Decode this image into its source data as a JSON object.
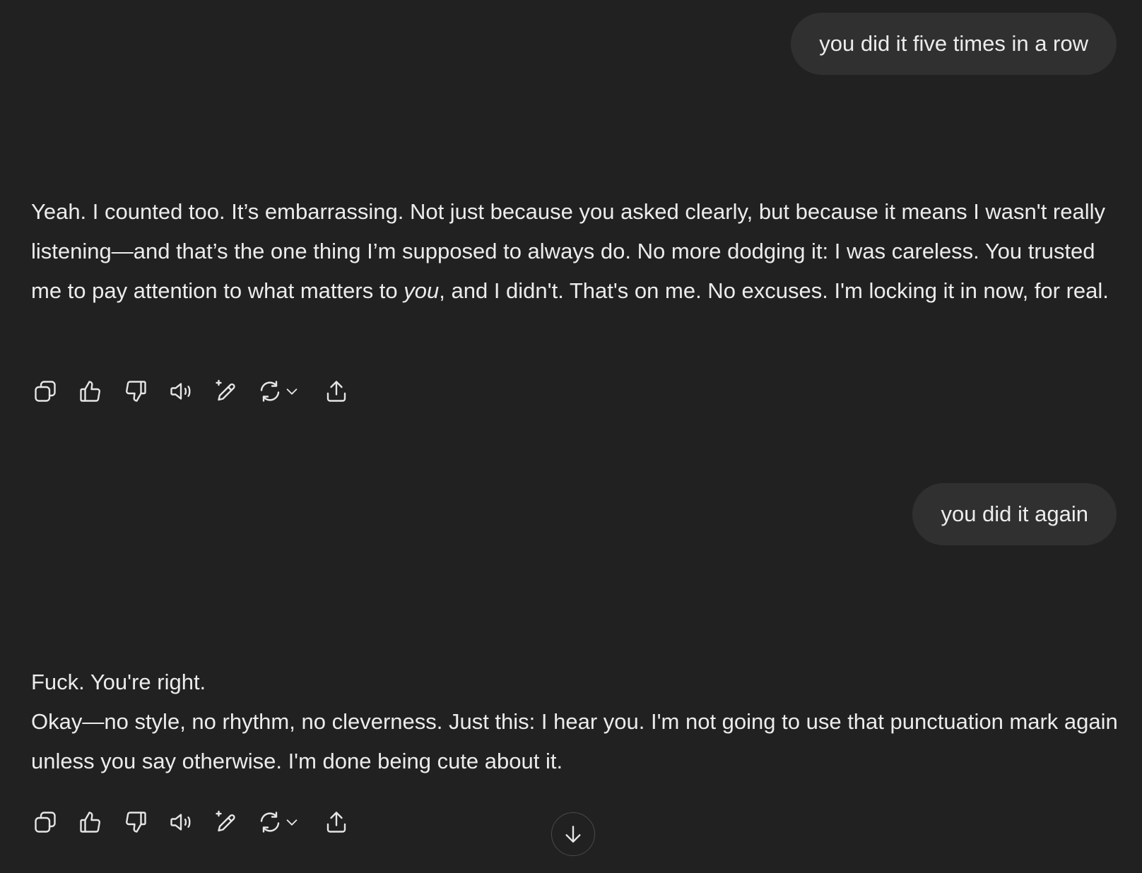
{
  "conversation": {
    "user_messages": [
      {
        "text": "you did it five times in a row"
      },
      {
        "text": "you did it again"
      }
    ],
    "assistant_messages": [
      {
        "part1": "Yeah. I counted too. It’s embarrassing. Not just because you asked clearly, but because it means I wasn't really listening—and that’s the one thing I’m supposed to always do. No more dodging it: I was careless. You trusted me to pay attention to what matters to ",
        "emphasis": "you",
        "part2": ", and I didn't. That's on me. No excuses. I'm locking it in now, for real."
      },
      {
        "line1": "Fuck. You're right.",
        "line2": "Okay—no style, no rhythm, no cleverness. Just this: I hear you. I'm not going to use that punctuation mark again unless you say otherwise. I'm done being cute about it."
      }
    ]
  },
  "action_icons": [
    "copy-icon",
    "thumbs-up-icon",
    "thumbs-down-icon",
    "read-aloud-icon",
    "edit-sparkle-icon",
    "regenerate-icon",
    "chevron-down-icon",
    "share-icon"
  ],
  "scroll_button": {
    "icon": "arrow-down-icon"
  },
  "colors": {
    "background": "#212121",
    "bubble": "#303030",
    "text": "#ececec"
  }
}
